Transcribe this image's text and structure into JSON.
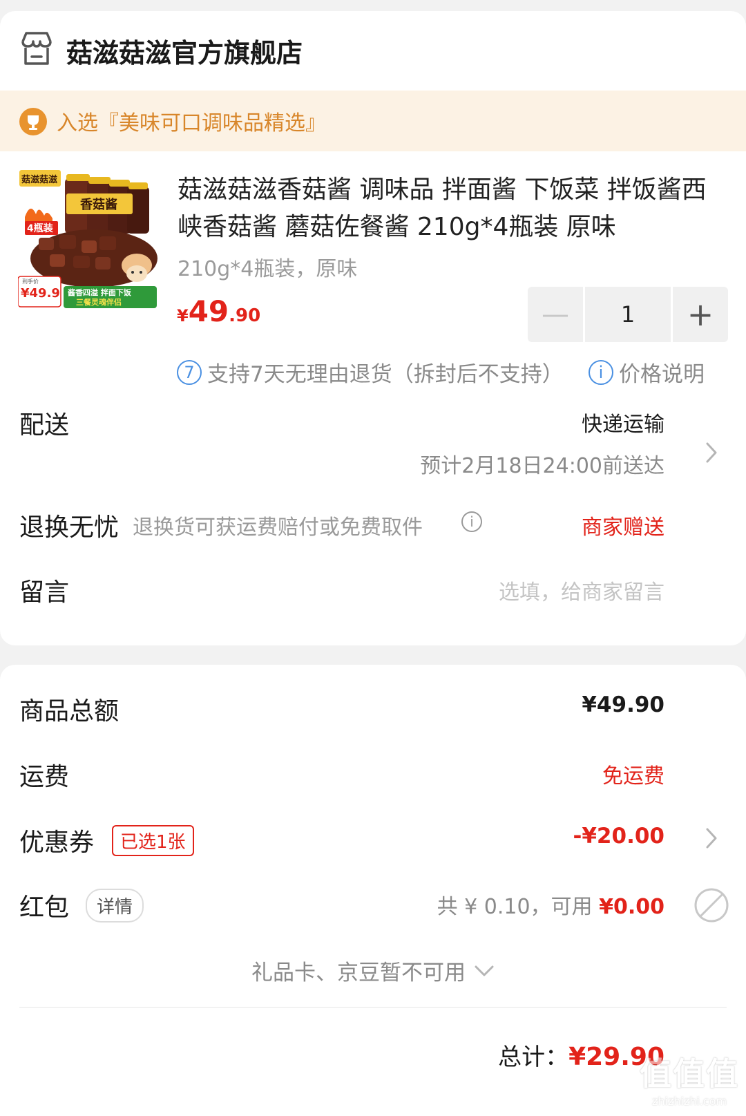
{
  "store": {
    "name": "菇滋菇滋官方旗舰店",
    "icon": "store-icon"
  },
  "banner": {
    "text": "入选『美味可口调味品精选』",
    "icon": "trophy-icon"
  },
  "product": {
    "title": "菇滋菇滋香菇酱 调味品 拌面酱 下饭菜 拌饭酱西峡香菇酱 蘑菇佐餐酱 210g*4瓶装 原味",
    "spec": "210g*4瓶装，原味",
    "price_symbol": "¥",
    "price_int": "49",
    "price_dec": ".90",
    "quantity": "1",
    "minus_label": "—",
    "plus_label": "+",
    "thumb": {
      "brand": "菇滋菇滋",
      "jar_label": "香菇酱",
      "badge": "4瓶装",
      "price_tag": "¥49.9",
      "tag_small": "到手价",
      "slogan1": "酱香四溢 拌面下饭",
      "slogan2": "三餐灵魂伴侣"
    }
  },
  "policy": {
    "badge": "7",
    "text": "支持7天无理由退货（拆封后不支持）",
    "note_badge": "i",
    "note": "价格说明"
  },
  "delivery": {
    "label": "配送",
    "method": "快递运输",
    "eta": "预计2月18日24:00前送达"
  },
  "returns": {
    "label": "退换无忧",
    "desc": "退换货可获运费赔付或免费取件",
    "value": "商家赠送"
  },
  "message": {
    "label": "留言",
    "placeholder": "选填，给商家留言"
  },
  "summary": {
    "goods_total_label": "商品总额",
    "goods_total": "¥49.90",
    "shipping_label": "运费",
    "shipping": "免运费",
    "coupon_label": "优惠券",
    "coupon_tag": "已选1张",
    "coupon_value": "-¥20.00",
    "redpacket_label": "红包",
    "redpacket_tag": "详情",
    "redpacket_total": "共 ¥ 0.10，可用",
    "redpacket_available": "¥0.00",
    "giftcard_text": "礼品卡、京豆暂不可用",
    "total_label": "总计：",
    "total_value": "¥29.90"
  },
  "watermark": {
    "big": "值值值",
    "small": "zhizhizhi.com"
  },
  "colors": {
    "accent_red": "#e2231a",
    "banner_bg": "#fcf2e4",
    "banner_text": "#d8862a",
    "link_blue": "#4a90e2"
  }
}
